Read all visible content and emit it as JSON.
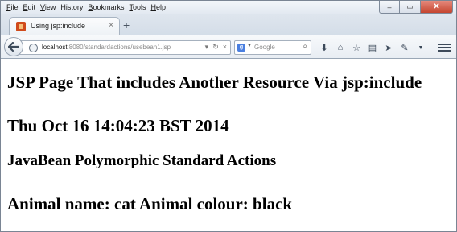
{
  "menu": [
    {
      "label": "File",
      "access": "F",
      "rest": "ile"
    },
    {
      "label": "Edit",
      "access": "E",
      "rest": "dit"
    },
    {
      "label": "View",
      "access": "V",
      "rest": "iew"
    },
    {
      "label": "History",
      "access": "",
      "rest": "History"
    },
    {
      "label": "Bookmarks",
      "access": "B",
      "rest": "ookmarks"
    },
    {
      "label": "Tools",
      "access": "T",
      "rest": "ools"
    },
    {
      "label": "Help",
      "access": "H",
      "rest": "elp"
    }
  ],
  "window_controls": {
    "minimize": "–",
    "maximize": "▭",
    "close": "✕"
  },
  "tab": {
    "title": "Using jsp:include",
    "close": "×"
  },
  "newtab": "+",
  "address": {
    "host": "localhost",
    "path": ":8080/standardactions/usebean1.jsp"
  },
  "search": {
    "placeholder": "Google"
  },
  "page": {
    "heading": "JSP Page That includes Another Resource Via jsp:include",
    "date": "Thu Oct 16 14:04:23 BST 2014",
    "subheading": "JavaBean Polymorphic Standard Actions",
    "animal_line": "Animal name: cat Animal colour: black"
  },
  "colors": {
    "close_button": "#c5452f",
    "search_badge": "#4a7fe0",
    "favicon": "#d04a1b"
  }
}
